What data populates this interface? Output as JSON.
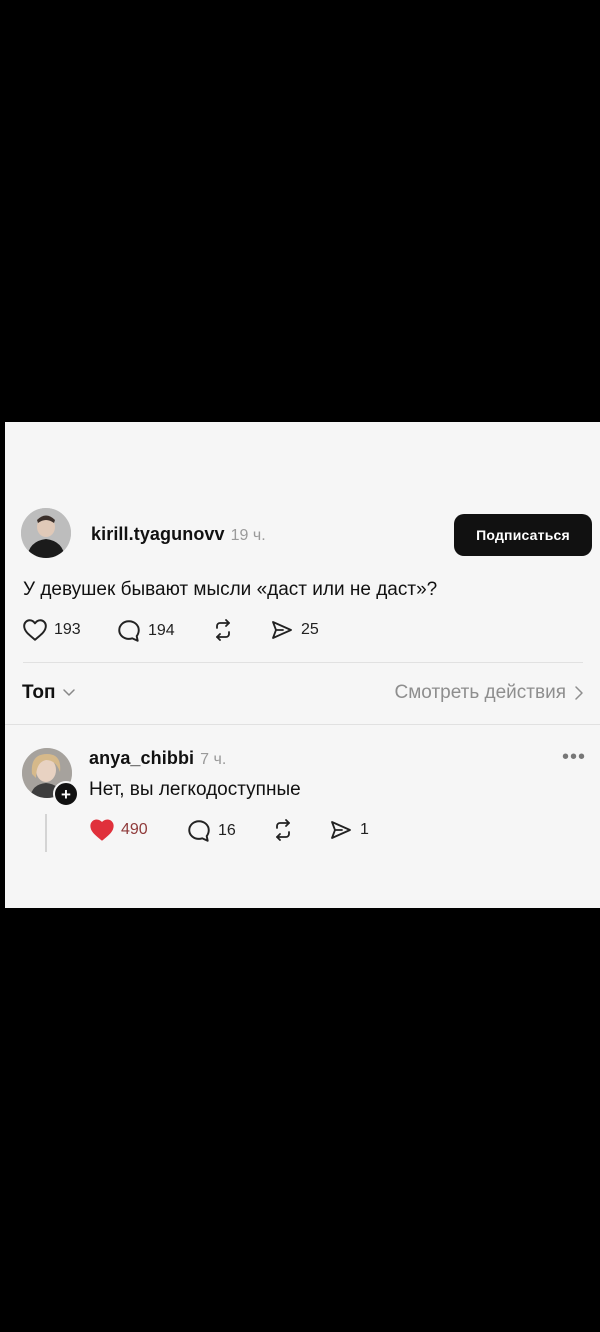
{
  "post": {
    "username": "kirill.tyagunovv",
    "time": "19 ч.",
    "subscribe_label": "Подписаться",
    "text": "У девушек бывают мысли «даст или не даст»?",
    "likes": "193",
    "comments": "194",
    "shares": "25"
  },
  "filter": {
    "sort_label": "Топ",
    "activity_label": "Смотреть действия"
  },
  "reply": {
    "username": "anya_chibbi",
    "time": "7 ч.",
    "text": "Нет, вы легкодоступные",
    "likes": "490",
    "comments": "16",
    "shares": "1",
    "more": "•••"
  },
  "colors": {
    "background": "#000000",
    "panel": "#f6f6f6",
    "button": "#111111",
    "like_red": "#e0303b"
  }
}
